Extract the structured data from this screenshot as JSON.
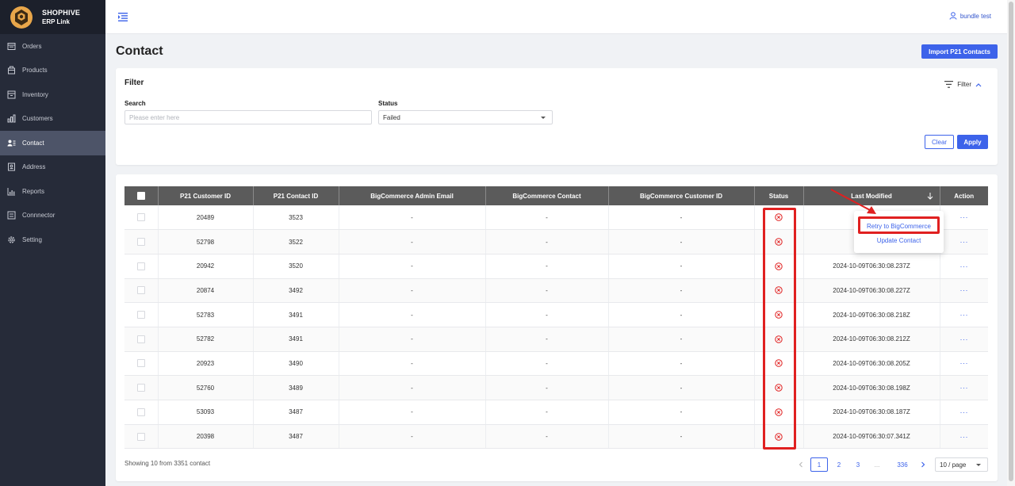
{
  "brand": {
    "name": "SHOPHIVE",
    "sub": "ERP Link"
  },
  "sidebar": {
    "items": [
      {
        "label": "Orders",
        "icon": "orders-icon"
      },
      {
        "label": "Products",
        "icon": "products-icon"
      },
      {
        "label": "Inventory",
        "icon": "inventory-icon"
      },
      {
        "label": "Customers",
        "icon": "customers-icon"
      },
      {
        "label": "Contact",
        "icon": "contact-icon",
        "active": true
      },
      {
        "label": "Address",
        "icon": "address-icon"
      },
      {
        "label": "Reports",
        "icon": "reports-icon"
      },
      {
        "label": "Connnector",
        "icon": "connector-icon"
      },
      {
        "label": "Setting",
        "icon": "gear-icon"
      }
    ]
  },
  "header": {
    "user": "bundle test"
  },
  "page": {
    "title": "Contact",
    "import_label": "Import P21 Contacts"
  },
  "filter": {
    "title": "Filter",
    "toggle_label": "Filter",
    "search_label": "Search",
    "search_placeholder": "Please enter here",
    "status_label": "Status",
    "status_value": "Failed",
    "clear_label": "Clear",
    "apply_label": "Apply"
  },
  "table": {
    "columns": [
      "P21 Customer ID",
      "P21 Contact ID",
      "BigCommerce Admin Email",
      "BigCommerce Contact",
      "BigCommerce Customer ID",
      "Status",
      "Last Modified",
      "Action"
    ],
    "rows": [
      {
        "customer_id": "20489",
        "contact_id": "3523",
        "email": "-",
        "contact": "-",
        "bc_customer_id": "-",
        "status": "failed",
        "modified": "2024-1",
        "action": "···"
      },
      {
        "customer_id": "52798",
        "contact_id": "3522",
        "email": "-",
        "contact": "-",
        "bc_customer_id": "-",
        "status": "failed",
        "modified": "2024-1",
        "action": "···"
      },
      {
        "customer_id": "20942",
        "contact_id": "3520",
        "email": "-",
        "contact": "-",
        "bc_customer_id": "-",
        "status": "failed",
        "modified": "2024-10-09T06:30:08.237Z",
        "action": "···"
      },
      {
        "customer_id": "20874",
        "contact_id": "3492",
        "email": "-",
        "contact": "-",
        "bc_customer_id": "-",
        "status": "failed",
        "modified": "2024-10-09T06:30:08.227Z",
        "action": "···"
      },
      {
        "customer_id": "52783",
        "contact_id": "3491",
        "email": "-",
        "contact": "-",
        "bc_customer_id": "-",
        "status": "failed",
        "modified": "2024-10-09T06:30:08.218Z",
        "action": "···"
      },
      {
        "customer_id": "52782",
        "contact_id": "3491",
        "email": "-",
        "contact": "-",
        "bc_customer_id": "-",
        "status": "failed",
        "modified": "2024-10-09T06:30:08.212Z",
        "action": "···"
      },
      {
        "customer_id": "20923",
        "contact_id": "3490",
        "email": "-",
        "contact": "-",
        "bc_customer_id": "-",
        "status": "failed",
        "modified": "2024-10-09T06:30:08.205Z",
        "action": "···"
      },
      {
        "customer_id": "52760",
        "contact_id": "3489",
        "email": "-",
        "contact": "-",
        "bc_customer_id": "-",
        "status": "failed",
        "modified": "2024-10-09T06:30:08.198Z",
        "action": "···"
      },
      {
        "customer_id": "53093",
        "contact_id": "3487",
        "email": "-",
        "contact": "-",
        "bc_customer_id": "-",
        "status": "failed",
        "modified": "2024-10-09T06:30:08.187Z",
        "action": "···"
      },
      {
        "customer_id": "20398",
        "contact_id": "3487",
        "email": "-",
        "contact": "-",
        "bc_customer_id": "-",
        "status": "failed",
        "modified": "2024-10-09T06:30:07.341Z",
        "action": "···"
      }
    ]
  },
  "action_menu": {
    "retry": "Retry to BigCommerce",
    "update": "Update Contact"
  },
  "footer": {
    "showing": "Showing 10 from 3351 contact",
    "pages": [
      "1",
      "2",
      "3",
      "...",
      "336"
    ],
    "current_page": "1",
    "page_size": "10 / page"
  },
  "colors": {
    "accent": "#3d63ea",
    "status_failed": "#e02020",
    "sidebar": "#262b39",
    "annotation": "#e02020"
  }
}
